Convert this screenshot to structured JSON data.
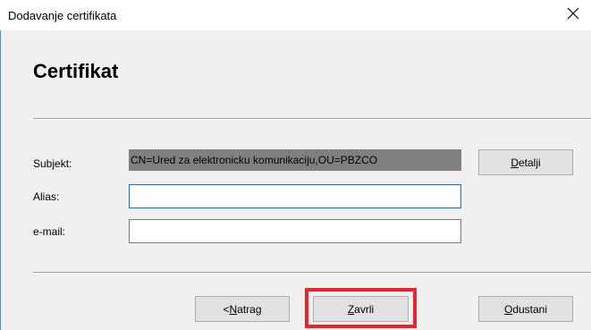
{
  "window": {
    "title": "Dodavanje certifikata",
    "close_icon": "close-icon"
  },
  "header": {
    "heading": "Certifikat"
  },
  "form": {
    "subject": {
      "label": "Subjekt:",
      "value": "CN=Ured za elektronicku komunikaciju,OU=PBZCO"
    },
    "alias": {
      "label": "Alias:",
      "value": ""
    },
    "email": {
      "label": "e-mail:",
      "value": ""
    }
  },
  "buttons": {
    "details": {
      "pre": "",
      "accel": "D",
      "post": "etalji"
    },
    "back": {
      "pre": "< ",
      "accel": "N",
      "post": "atrag"
    },
    "finish": {
      "pre": "",
      "accel": "Z",
      "post": "avrli"
    },
    "cancel": {
      "pre": "",
      "accel": "O",
      "post": "dustani"
    }
  },
  "colors": {
    "highlight": "#e8252a",
    "focus": "#0078d7",
    "subject_bg": "#808080"
  }
}
